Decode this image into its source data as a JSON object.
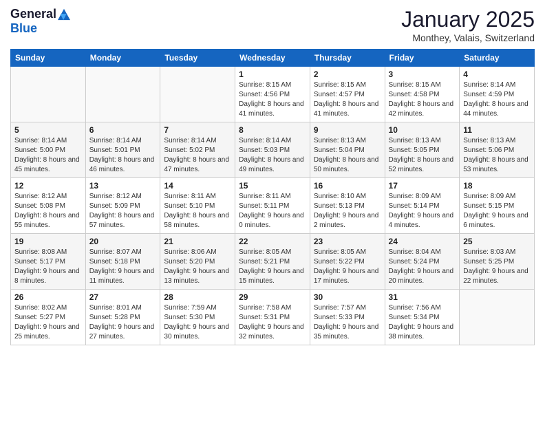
{
  "logo": {
    "general": "General",
    "blue": "Blue"
  },
  "title": "January 2025",
  "location": "Monthey, Valais, Switzerland",
  "days_header": [
    "Sunday",
    "Monday",
    "Tuesday",
    "Wednesday",
    "Thursday",
    "Friday",
    "Saturday"
  ],
  "weeks": [
    [
      {
        "day": "",
        "info": ""
      },
      {
        "day": "",
        "info": ""
      },
      {
        "day": "",
        "info": ""
      },
      {
        "day": "1",
        "info": "Sunrise: 8:15 AM\nSunset: 4:56 PM\nDaylight: 8 hours and 41 minutes."
      },
      {
        "day": "2",
        "info": "Sunrise: 8:15 AM\nSunset: 4:57 PM\nDaylight: 8 hours and 41 minutes."
      },
      {
        "day": "3",
        "info": "Sunrise: 8:15 AM\nSunset: 4:58 PM\nDaylight: 8 hours and 42 minutes."
      },
      {
        "day": "4",
        "info": "Sunrise: 8:14 AM\nSunset: 4:59 PM\nDaylight: 8 hours and 44 minutes."
      }
    ],
    [
      {
        "day": "5",
        "info": "Sunrise: 8:14 AM\nSunset: 5:00 PM\nDaylight: 8 hours and 45 minutes."
      },
      {
        "day": "6",
        "info": "Sunrise: 8:14 AM\nSunset: 5:01 PM\nDaylight: 8 hours and 46 minutes."
      },
      {
        "day": "7",
        "info": "Sunrise: 8:14 AM\nSunset: 5:02 PM\nDaylight: 8 hours and 47 minutes."
      },
      {
        "day": "8",
        "info": "Sunrise: 8:14 AM\nSunset: 5:03 PM\nDaylight: 8 hours and 49 minutes."
      },
      {
        "day": "9",
        "info": "Sunrise: 8:13 AM\nSunset: 5:04 PM\nDaylight: 8 hours and 50 minutes."
      },
      {
        "day": "10",
        "info": "Sunrise: 8:13 AM\nSunset: 5:05 PM\nDaylight: 8 hours and 52 minutes."
      },
      {
        "day": "11",
        "info": "Sunrise: 8:13 AM\nSunset: 5:06 PM\nDaylight: 8 hours and 53 minutes."
      }
    ],
    [
      {
        "day": "12",
        "info": "Sunrise: 8:12 AM\nSunset: 5:08 PM\nDaylight: 8 hours and 55 minutes."
      },
      {
        "day": "13",
        "info": "Sunrise: 8:12 AM\nSunset: 5:09 PM\nDaylight: 8 hours and 57 minutes."
      },
      {
        "day": "14",
        "info": "Sunrise: 8:11 AM\nSunset: 5:10 PM\nDaylight: 8 hours and 58 minutes."
      },
      {
        "day": "15",
        "info": "Sunrise: 8:11 AM\nSunset: 5:11 PM\nDaylight: 9 hours and 0 minutes."
      },
      {
        "day": "16",
        "info": "Sunrise: 8:10 AM\nSunset: 5:13 PM\nDaylight: 9 hours and 2 minutes."
      },
      {
        "day": "17",
        "info": "Sunrise: 8:09 AM\nSunset: 5:14 PM\nDaylight: 9 hours and 4 minutes."
      },
      {
        "day": "18",
        "info": "Sunrise: 8:09 AM\nSunset: 5:15 PM\nDaylight: 9 hours and 6 minutes."
      }
    ],
    [
      {
        "day": "19",
        "info": "Sunrise: 8:08 AM\nSunset: 5:17 PM\nDaylight: 9 hours and 8 minutes."
      },
      {
        "day": "20",
        "info": "Sunrise: 8:07 AM\nSunset: 5:18 PM\nDaylight: 9 hours and 11 minutes."
      },
      {
        "day": "21",
        "info": "Sunrise: 8:06 AM\nSunset: 5:20 PM\nDaylight: 9 hours and 13 minutes."
      },
      {
        "day": "22",
        "info": "Sunrise: 8:05 AM\nSunset: 5:21 PM\nDaylight: 9 hours and 15 minutes."
      },
      {
        "day": "23",
        "info": "Sunrise: 8:05 AM\nSunset: 5:22 PM\nDaylight: 9 hours and 17 minutes."
      },
      {
        "day": "24",
        "info": "Sunrise: 8:04 AM\nSunset: 5:24 PM\nDaylight: 9 hours and 20 minutes."
      },
      {
        "day": "25",
        "info": "Sunrise: 8:03 AM\nSunset: 5:25 PM\nDaylight: 9 hours and 22 minutes."
      }
    ],
    [
      {
        "day": "26",
        "info": "Sunrise: 8:02 AM\nSunset: 5:27 PM\nDaylight: 9 hours and 25 minutes."
      },
      {
        "day": "27",
        "info": "Sunrise: 8:01 AM\nSunset: 5:28 PM\nDaylight: 9 hours and 27 minutes."
      },
      {
        "day": "28",
        "info": "Sunrise: 7:59 AM\nSunset: 5:30 PM\nDaylight: 9 hours and 30 minutes."
      },
      {
        "day": "29",
        "info": "Sunrise: 7:58 AM\nSunset: 5:31 PM\nDaylight: 9 hours and 32 minutes."
      },
      {
        "day": "30",
        "info": "Sunrise: 7:57 AM\nSunset: 5:33 PM\nDaylight: 9 hours and 35 minutes."
      },
      {
        "day": "31",
        "info": "Sunrise: 7:56 AM\nSunset: 5:34 PM\nDaylight: 9 hours and 38 minutes."
      },
      {
        "day": "",
        "info": ""
      }
    ]
  ]
}
